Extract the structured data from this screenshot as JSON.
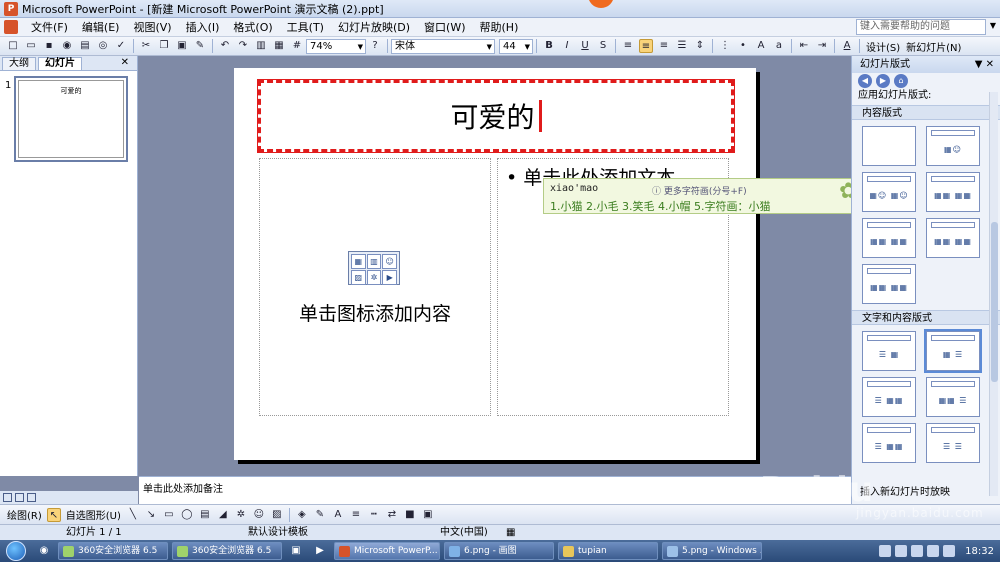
{
  "window": {
    "title": "Microsoft PowerPoint - [新建 Microsoft PowerPoint 演示文稿 (2).ppt]"
  },
  "menu": {
    "items": [
      "文件(F)",
      "编辑(E)",
      "视图(V)",
      "插入(I)",
      "格式(O)",
      "工具(T)",
      "幻灯片放映(D)",
      "窗口(W)",
      "帮助(H)"
    ],
    "help_placeholder": "键入需要帮助的问题"
  },
  "toolbar": {
    "zoom": "74%",
    "font": "宋体",
    "size": "44",
    "bold": "B",
    "italic": "I",
    "underline": "U",
    "shadow": "S",
    "design_label": "设计(S)",
    "new_slide_label": "新幻灯片(N)"
  },
  "left_panel": {
    "tabs": [
      "大纲",
      "幻灯片"
    ],
    "slide_number": "1",
    "thumb_title": "可爱的"
  },
  "slide": {
    "title": "可爱的",
    "content_hint": "单击图标添加内容",
    "bullet_text": "单击此处添加文本"
  },
  "ime": {
    "pinyin": "xiao'mao",
    "more_label": "更多字符画(分号+F)",
    "candidates": "1.小猫  2.小毛  3.笑毛  4.小帽  5.字符画：小猫"
  },
  "task_pane": {
    "title": "幻灯片版式",
    "apply_label": "应用幻灯片版式:",
    "section_content": "内容版式",
    "section_text_content": "文字和内容版式",
    "footer": "插入新幻灯片时放映"
  },
  "notes": {
    "placeholder": "单击此处添加备注"
  },
  "drawbar": {
    "draw_label": "绘图(R)",
    "autoshape_label": "自选图形(U)"
  },
  "status": {
    "slide": "幻灯片 1 / 1",
    "template": "默认设计模板",
    "language": "中文(中国)"
  },
  "taskbar": {
    "items": [
      "360安全浏览器 6.5",
      "360安全浏览器 6.5",
      "Microsoft PowerP...",
      "6.png - 画图",
      "tupian",
      "5.png - Windows ..."
    ],
    "clock": "18:32"
  },
  "watermark": {
    "text": "Baidu",
    "sub": "jingyan.baidu.com"
  }
}
